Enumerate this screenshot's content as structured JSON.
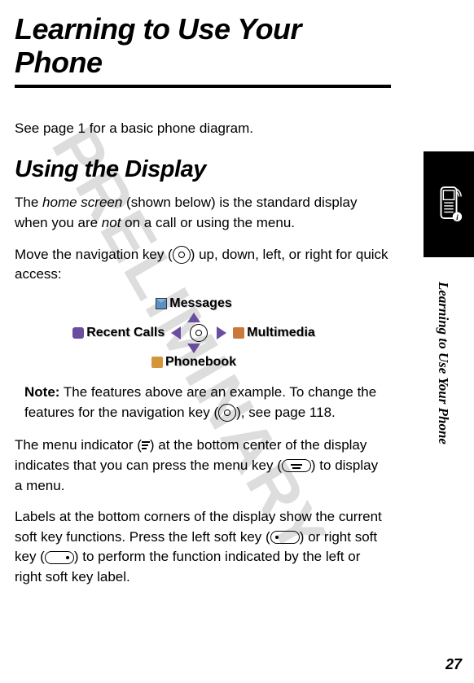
{
  "watermark": "PRELIMINARY",
  "title": "Learning to Use Your Phone",
  "intro": "See page 1 for a basic phone diagram.",
  "section_heading": "Using the Display",
  "para1_pre": "The ",
  "para1_term": "home screen",
  "para1_mid": " (shown below) is the standard display when you are ",
  "para1_term2": "not",
  "para1_post": " on a call or using the menu.",
  "para2_pre": "Move the navigation key (",
  "para2_post": ") up, down, left, or right for quick access:",
  "nav": {
    "up": "Messages",
    "left": "Recent Calls",
    "right": "Multimedia",
    "down": "Phonebook"
  },
  "note": {
    "label": "Note:",
    "pre": " The features above are an example. To change the features for the navigation key (",
    "post": "), see page 118."
  },
  "para3_pre": "The menu indicator (",
  "para3_mid": ") at the bottom center of the display indicates that you can press the menu key (",
  "para3_post": ") to display a menu.",
  "para4_pre": "Labels at the bottom corners of the display show the current soft key functions. Press the left soft key (",
  "para4_mid": ") or right soft key (",
  "para4_post": ") to perform the function indicated by the left or right soft key label.",
  "sidebar_text": "Learning to Use Your Phone",
  "page_number": "27"
}
